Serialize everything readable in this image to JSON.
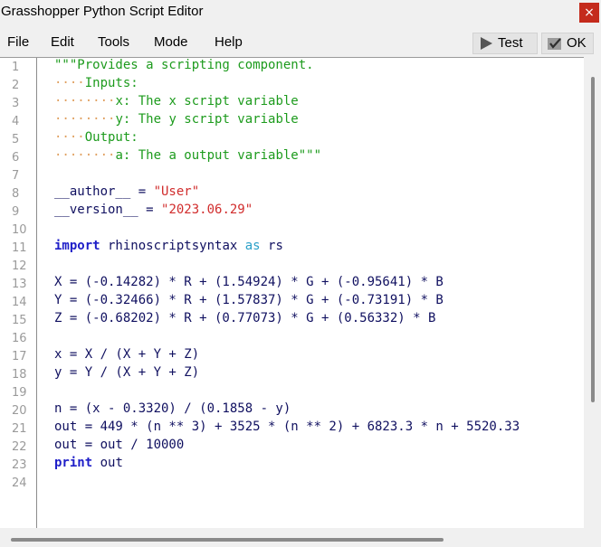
{
  "window": {
    "title": "Grasshopper Python Script Editor",
    "close_label": "×"
  },
  "menu": {
    "items": [
      "File",
      "Edit",
      "Tools",
      "Mode",
      "Help"
    ]
  },
  "toolbar": {
    "test_label": "Test",
    "ok_label": "OK"
  },
  "editor": {
    "line_numbers": [
      "1",
      "2",
      "3",
      "4",
      "5",
      "6",
      "7",
      "8",
      "9",
      "10",
      "11",
      "12",
      "13",
      "14",
      "15",
      "16",
      "17",
      "18",
      "19",
      "20",
      "21",
      "22",
      "23",
      "24"
    ],
    "lines": {
      "l1": "\"\"\"Provides a scripting component.",
      "l2_dots": "····",
      "l2_text": "Inputs:",
      "l3_dots": "········",
      "l3_text": "x: The x script variable",
      "l4_dots": "········",
      "l4_text": "y: The y script variable",
      "l5_dots": "····",
      "l5_text": "Output:",
      "l6_dots": "········",
      "l6_text": "a: The a output variable\"\"\"",
      "l8_a": "__author__ = ",
      "l8_b": "\"User\"",
      "l9_a": "__version__ = ",
      "l9_b": "\"2023.06.29\"",
      "l11_a": "import",
      "l11_b": " rhinoscriptsyntax ",
      "l11_c": "as",
      "l11_d": " rs",
      "l13": "X = (-0.14282) * R + (1.54924) * G + (-0.95641) * B",
      "l14": "Y = (-0.32466) * R + (1.57837) * G + (-0.73191) * B",
      "l15": "Z = (-0.68202) * R + (0.77073) * G + (0.56332) * B",
      "l17": "x = X / (X + Y + Z)",
      "l18": "y = Y / (X + Y + Z)",
      "l20": "n = (x - 0.3320) / (0.1858 - y)",
      "l21": "out = 449 * (n ** 3) + 3525 * (n ** 2) + 6823.3 * n + 5520.33",
      "l22": "out = out / 10000",
      "l23_a": "print",
      "l23_b": " out"
    }
  }
}
